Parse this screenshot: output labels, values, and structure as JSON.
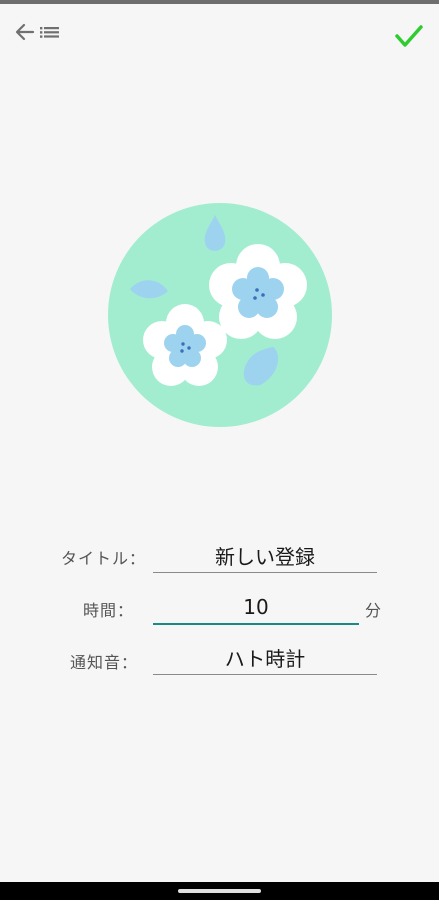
{
  "form": {
    "title_label": "タイトル：",
    "title_value": "新しい登録",
    "time_label": "時間：",
    "time_value": "10",
    "time_unit": "分",
    "sound_label": "通知音：",
    "sound_value": "ハト時計"
  },
  "icons": {
    "back": "arrow-left-icon",
    "list": "list-icon",
    "confirm": "checkmark-icon"
  },
  "colors": {
    "accent": "#1b8a86",
    "confirm": "#2ecc2e",
    "circle_bg": "#a2edd0",
    "flower_blue": "#9dd3ef"
  }
}
